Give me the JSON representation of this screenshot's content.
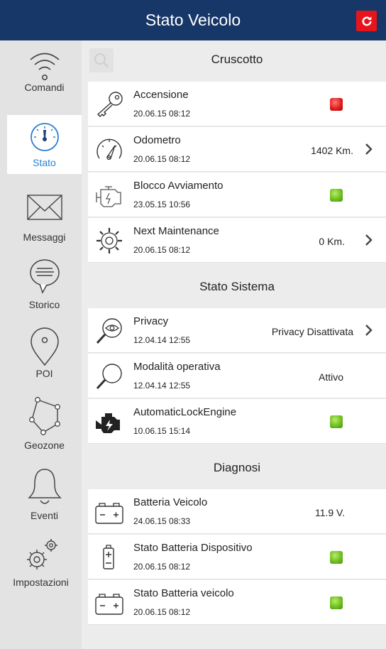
{
  "header": {
    "title": "Stato Veicolo"
  },
  "sidebar": {
    "items": [
      {
        "label": "Comandi",
        "icon": "wifi-signal-icon"
      },
      {
        "label": "Stato",
        "icon": "gauge-icon",
        "active": true
      },
      {
        "label": "Messaggi",
        "icon": "envelope-icon"
      },
      {
        "label": "Storico",
        "icon": "chat-bubble-icon"
      },
      {
        "label": "POI",
        "icon": "map-pin-icon"
      },
      {
        "label": "Geozone",
        "icon": "polygon-icon"
      },
      {
        "label": "Eventi",
        "icon": "bell-icon"
      },
      {
        "label": "Impostazioni",
        "icon": "gears-icon"
      }
    ]
  },
  "sections": {
    "cruscotto": {
      "title": "Cruscotto",
      "rows": [
        {
          "title": "Accensione",
          "date": "20.06.15 08:12",
          "status": "red"
        },
        {
          "title": "Odometro",
          "date": "20.06.15 08:12",
          "value": "1402 Km."
        },
        {
          "title": "Blocco Avviamento",
          "date": "23.05.15 10:56",
          "status": "green"
        },
        {
          "title": "Next Maintenance",
          "date": "20.06.15 08:12",
          "value": "0 Km."
        }
      ]
    },
    "sistema": {
      "title": "Stato Sistema",
      "rows": [
        {
          "title": "Privacy",
          "date": "12.04.14 12:55",
          "value": "Privacy Disattivata"
        },
        {
          "title": "Modalità operativa",
          "date": "12.04.14 12:55",
          "value": "Attivo"
        },
        {
          "title": "AutomaticLockEngine",
          "date": "10.06.15 15:14",
          "status": "green"
        }
      ]
    },
    "diagnosi": {
      "title": "Diagnosi",
      "rows": [
        {
          "title": "Batteria Veicolo",
          "date": "24.06.15 08:33",
          "value": "11.9 V."
        },
        {
          "title": "Stato Batteria Dispositivo",
          "date": "20.06.15 08:12",
          "status": "green"
        },
        {
          "title": "Stato Batteria veicolo",
          "date": "20.06.15 08:12",
          "status": "green"
        }
      ]
    }
  },
  "colors": {
    "header_bg": "#173768",
    "refresh_bg": "#e8141b",
    "active_blue": "#2a7fd4",
    "led_red": "#e11e1e",
    "led_green": "#6ebf1f"
  }
}
